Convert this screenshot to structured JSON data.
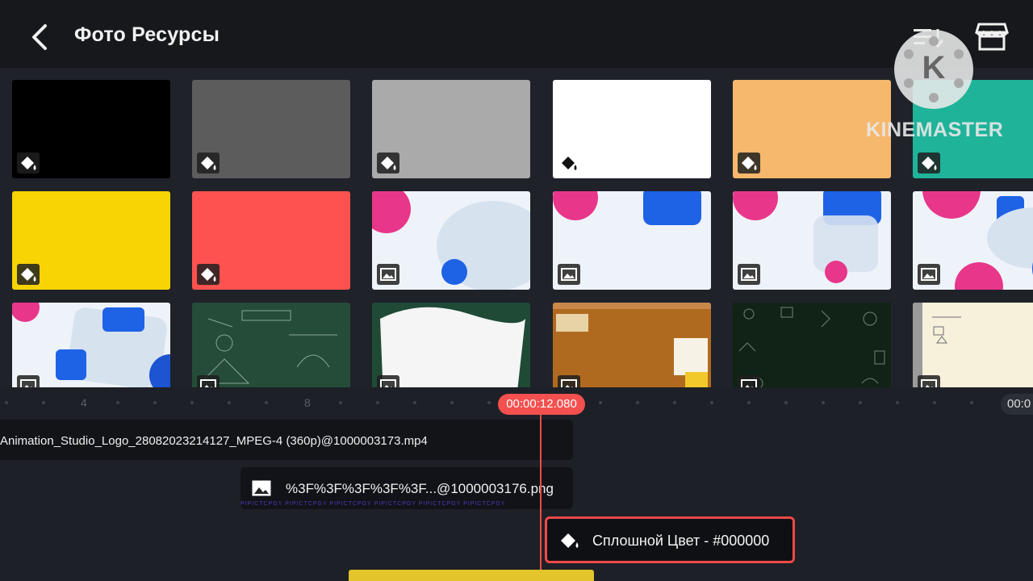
{
  "header": {
    "title": "Фото Ресурсы",
    "back_icon": "chevron-left-icon",
    "sort_icon": "sort-list-icon",
    "store_icon": "store-icon"
  },
  "watermark": {
    "text": "KINEMASTER",
    "logo_letter": "K"
  },
  "tiles": [
    {
      "kind": "color",
      "color": "#000000"
    },
    {
      "kind": "color",
      "color": "#5c5c5c"
    },
    {
      "kind": "color",
      "color": "#aaaaaa"
    },
    {
      "kind": "color",
      "color": "#ffffff"
    },
    {
      "kind": "color",
      "color": "#f6b86c"
    },
    {
      "kind": "color",
      "color": "#1fb39a"
    },
    {
      "kind": "color",
      "color": "#f8d404"
    },
    {
      "kind": "color",
      "color": "#fd524f"
    },
    {
      "kind": "image",
      "theme": "bubbles"
    },
    {
      "kind": "image",
      "theme": "bubbles"
    },
    {
      "kind": "image",
      "theme": "bubbles"
    },
    {
      "kind": "image",
      "theme": "bubbles"
    },
    {
      "kind": "image",
      "theme": "bubbles"
    },
    {
      "kind": "image",
      "theme": "chalkboard-green"
    },
    {
      "kind": "image",
      "theme": "white-scribble"
    },
    {
      "kind": "image",
      "theme": "corkboard"
    },
    {
      "kind": "image",
      "theme": "chalkboard-dark"
    },
    {
      "kind": "image",
      "theme": "notebook"
    }
  ],
  "timeline": {
    "ruler_labels": [
      "4",
      "8"
    ],
    "current_time": "00:00:12.080",
    "end_time": "00:0",
    "video_clip": "Animation_Studio_Logo_28082023214127_MPEG-4 (360p)@1000003173.mp4",
    "image_clip": "%3F%3F%3F%3F%3F...@1000003176.png",
    "image_clip_strip": "PIPICTCPGY PIPICTCPGY PIPICTCPGY PIPICTCPGY PIPICTCPGY PIPICTCPGY",
    "color_clip": "Сплошной Цвет - #000000",
    "colors": {
      "playhead": "#f24a49",
      "audio": "#e3c42b"
    }
  }
}
